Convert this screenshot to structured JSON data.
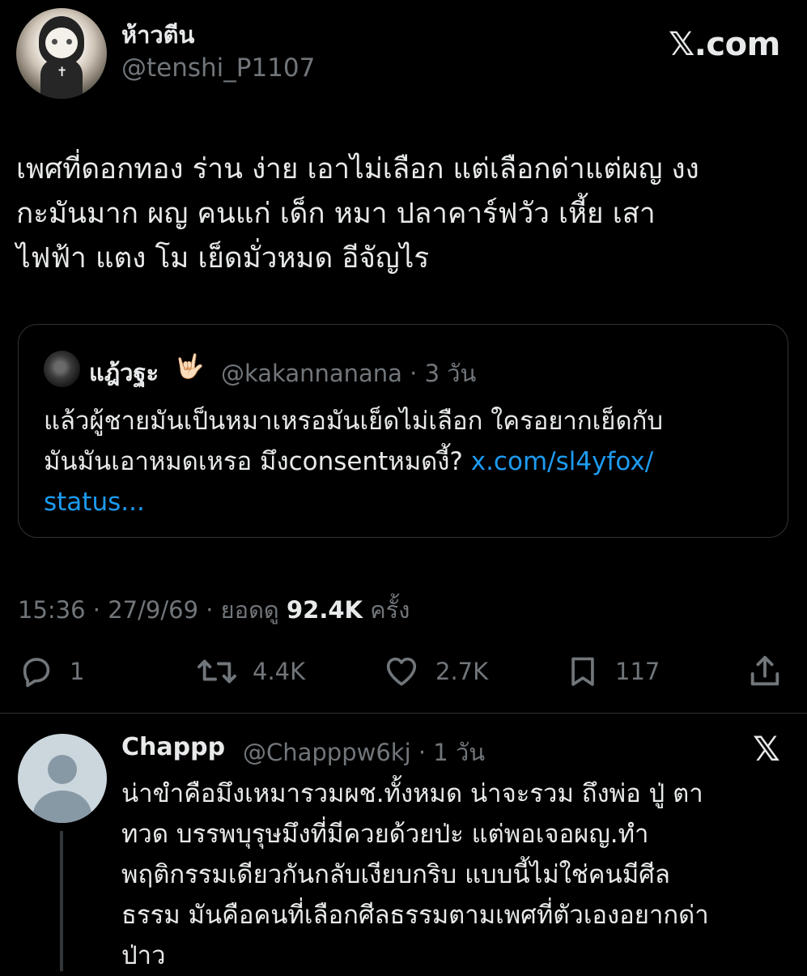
{
  "header": {
    "display_name": "ห้าวตีน",
    "handle": "@tenshi_P1107",
    "brand": "𝕏.com"
  },
  "tweet": {
    "lines": [
      "เพศที่ดอกทอง ร่าน ง่าย เอาไม่เลือก แต่เลือกด่าแต่ผญ งง",
      "กะมันมาก ผญ คนแก่ เด็ก หมา ปลาคาร์ฟวัว เหี้ย เสา",
      "ไฟฟ้า แตง โม เย็ดมั่วหมด อีจัญไร"
    ]
  },
  "quote": {
    "name": "แฎ้วฐะ",
    "emoji": "🤟🏻",
    "handle_time": "@kakannanana · 3 วัน",
    "lines": [
      "แล้วผู้ชายมันเป็นหมาเหรอมันเย็ดไม่เลือก ใครอยากเย็ดกับ",
      "มันมันเอาหมดเหรอ มึงconsentหมดงี้?"
    ],
    "link_part1": "x.com/sl4yfox/",
    "link_part2": "status..."
  },
  "meta": {
    "time_date": "15:36 · 27/9/69 · ยอดดู",
    "views": "92.4K",
    "views_suffix": "ครั้ง"
  },
  "actions": {
    "replies": "1",
    "reposts": "4.4K",
    "likes": "2.7K",
    "bookmarks": "117"
  },
  "reply": {
    "name": "Chappp",
    "handle_time": "@Chapppw6kj · 1 วัน",
    "brand_icon": "𝕏",
    "lines": [
      "น่าขำคือมึงเหมารวมผช.ทั้งหมด น่าจะรวม ถึงพ่อ ปู่ ตา",
      "ทวด บรรพบุรุษมึงที่มีควยด้วยป่ะ แต่พอเจอผญ.ทำ",
      "พฤติกรรมเดียวกันกลับเงียบกริบ แบบนี้ไม่ใช่คนมีศีล",
      "ธรรม มันคือคนที่เลือกศีลธรรมตามเพศที่ตัวเองอยากด่า",
      "ป่าว"
    ]
  },
  "colors": {
    "background": "#000000",
    "text": "#e7e9ea",
    "muted": "#71767b",
    "link": "#1d9bf0",
    "border": "#2f3336"
  }
}
